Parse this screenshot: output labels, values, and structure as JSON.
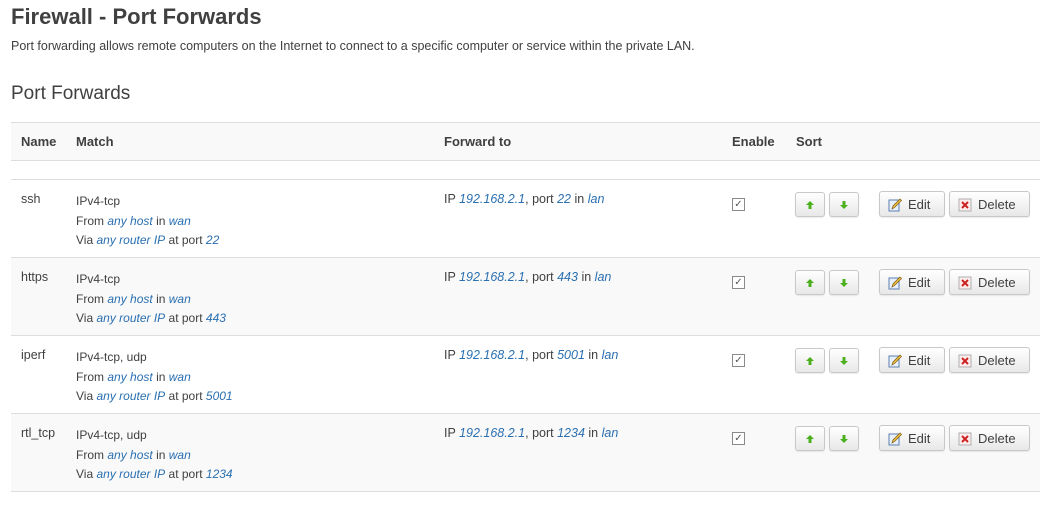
{
  "page": {
    "title": "Firewall - Port Forwards",
    "description": "Port forwarding allows remote computers on the Internet to connect to a specific computer or service within the private LAN.",
    "section_title": "Port Forwards"
  },
  "table": {
    "headers": {
      "name": "Name",
      "match": "Match",
      "forward": "Forward to",
      "enable": "Enable",
      "sort": "Sort"
    },
    "rows": [
      {
        "name": "ssh",
        "proto": "IPv4-tcp",
        "from_host": "any host",
        "from_zone": "wan",
        "via": "any router IP",
        "via_port": "22",
        "fwd_ip": "192.168.2.1",
        "fwd_port": "22",
        "fwd_zone": "lan",
        "enabled": true
      },
      {
        "name": "https",
        "proto": "IPv4-tcp",
        "from_host": "any host",
        "from_zone": "wan",
        "via": "any router IP",
        "via_port": "443",
        "fwd_ip": "192.168.2.1",
        "fwd_port": "443",
        "fwd_zone": "lan",
        "enabled": true
      },
      {
        "name": "iperf",
        "proto": "IPv4-tcp, udp",
        "from_host": "any host",
        "from_zone": "wan",
        "via": "any router IP",
        "via_port": "5001",
        "fwd_ip": "192.168.2.1",
        "fwd_port": "5001",
        "fwd_zone": "lan",
        "enabled": true
      },
      {
        "name": "rtl_tcp",
        "proto": "IPv4-tcp, udp",
        "from_host": "any host",
        "from_zone": "wan",
        "via": "any router IP",
        "via_port": "1234",
        "fwd_ip": "192.168.2.1",
        "fwd_port": "1234",
        "fwd_zone": "lan",
        "enabled": true
      }
    ]
  },
  "text": {
    "from": "From",
    "in": "in",
    "via": "Via",
    "at_port": "at port",
    "ip": "IP",
    "port": "port",
    "check_mark": "✓"
  },
  "buttons": {
    "edit": "Edit",
    "delete": "Delete"
  },
  "icons": {
    "move_up": "arrow-up-icon",
    "move_down": "arrow-down-icon",
    "edit": "edit-icon",
    "delete": "delete-icon"
  },
  "colors": {
    "link": "#2a6fb0",
    "arrow": "#4caf1e",
    "delete_icon": "#cc2222"
  }
}
